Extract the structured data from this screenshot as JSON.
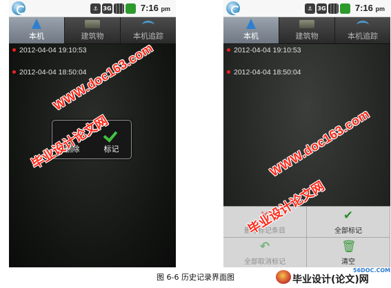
{
  "status_bar": {
    "time": "7:16",
    "time_suffix": "pm",
    "network": "3G"
  },
  "tabs": [
    {
      "label": "本机",
      "icon": "navigation-arrow-icon",
      "active": true
    },
    {
      "label": "建筑物",
      "icon": "building-icon",
      "active": false
    },
    {
      "label": "本机追踪",
      "icon": "track-icon",
      "active": false
    }
  ],
  "history": [
    {
      "timestamp": "2012-04-04 19:10:53"
    },
    {
      "timestamp": "2012-04-04 18:50:04"
    }
  ],
  "context_popup": {
    "delete_label": "删除",
    "mark_label": "标记"
  },
  "options_menu": {
    "delete_marked_label": "删除标记条目",
    "mark_all_label": "全部标记",
    "unmark_all_label": "全部取消标记",
    "clear_label": "清空"
  },
  "watermark": {
    "url": "WWW.doc163.com",
    "title": "毕业设计论文网"
  },
  "caption": "图 6-6  历史记录界面图",
  "corner_logo": {
    "text": "毕业设计(论文)网",
    "url": "56DOC.COM"
  },
  "colors": {
    "active_tab": "#8a939d",
    "bullet": "#ee2222",
    "watermark": "#ff2a1a",
    "check": "#42c242"
  }
}
